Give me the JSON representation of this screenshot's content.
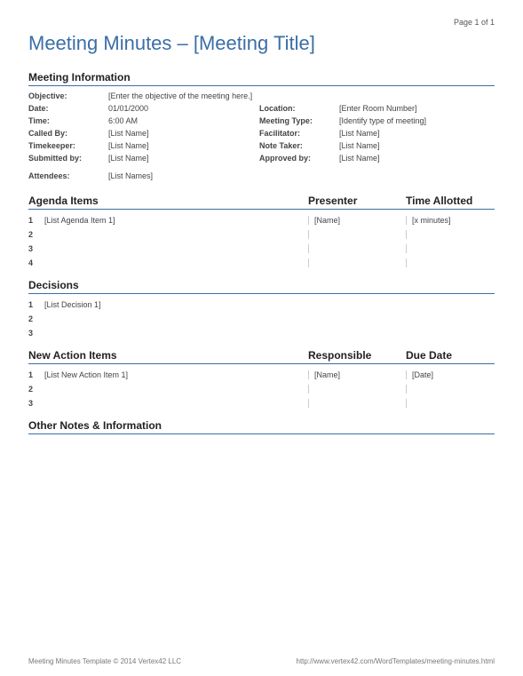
{
  "pageNum": "Page 1 of 1",
  "title": "Meeting Minutes – [Meeting Title]",
  "sections": {
    "info": {
      "heading": "Meeting Information",
      "rows": [
        {
          "l1": "Objective:",
          "v1": "[Enter the objective of the meeting here.]",
          "l2": "",
          "v2": ""
        },
        {
          "l1": "Date:",
          "v1": "01/01/2000",
          "l2": "Location:",
          "v2": "[Enter Room Number]"
        },
        {
          "l1": "Time:",
          "v1": "6:00 AM",
          "l2": "Meeting Type:",
          "v2": "[Identify type of meeting]"
        },
        {
          "l1": "Called By:",
          "v1": "[List Name]",
          "l2": "Facilitator:",
          "v2": "[List Name]"
        },
        {
          "l1": "Timekeeper:",
          "v1": "[List Name]",
          "l2": "Note Taker:",
          "v2": "[List Name]"
        },
        {
          "l1": "Submitted by:",
          "v1": "[List Name]",
          "l2": "Approved by:",
          "v2": "[List Name]"
        },
        {
          "l1": "Attendees:",
          "v1": "[List Names]",
          "l2": "",
          "v2": ""
        }
      ]
    },
    "agenda": {
      "heading": "Agenda Items",
      "col2": "Presenter",
      "col3": "Time Allotted",
      "rows": [
        {
          "n": "1",
          "d": "[List Agenda Item 1]",
          "c2": "[Name]",
          "c3": "[x minutes]"
        },
        {
          "n": "2",
          "d": "",
          "c2": "",
          "c3": ""
        },
        {
          "n": "3",
          "d": "",
          "c2": "",
          "c3": ""
        },
        {
          "n": "4",
          "d": "",
          "c2": "",
          "c3": ""
        }
      ]
    },
    "decisions": {
      "heading": "Decisions",
      "rows": [
        {
          "n": "1",
          "d": "[List Decision 1]"
        },
        {
          "n": "2",
          "d": ""
        },
        {
          "n": "3",
          "d": ""
        }
      ]
    },
    "actions": {
      "heading": "New Action Items",
      "col2": "Responsible",
      "col3": "Due Date",
      "rows": [
        {
          "n": "1",
          "d": "[List New Action Item 1]",
          "c2": "[Name]",
          "c3": "[Date]"
        },
        {
          "n": "2",
          "d": "",
          "c2": "",
          "c3": ""
        },
        {
          "n": "3",
          "d": "",
          "c2": "",
          "c3": ""
        }
      ]
    },
    "other": {
      "heading": "Other Notes & Information"
    }
  },
  "footer": {
    "left": "Meeting Minutes Template © 2014 Vertex42 LLC",
    "right": "http://www.vertex42.com/WordTemplates/meeting-minutes.html"
  }
}
